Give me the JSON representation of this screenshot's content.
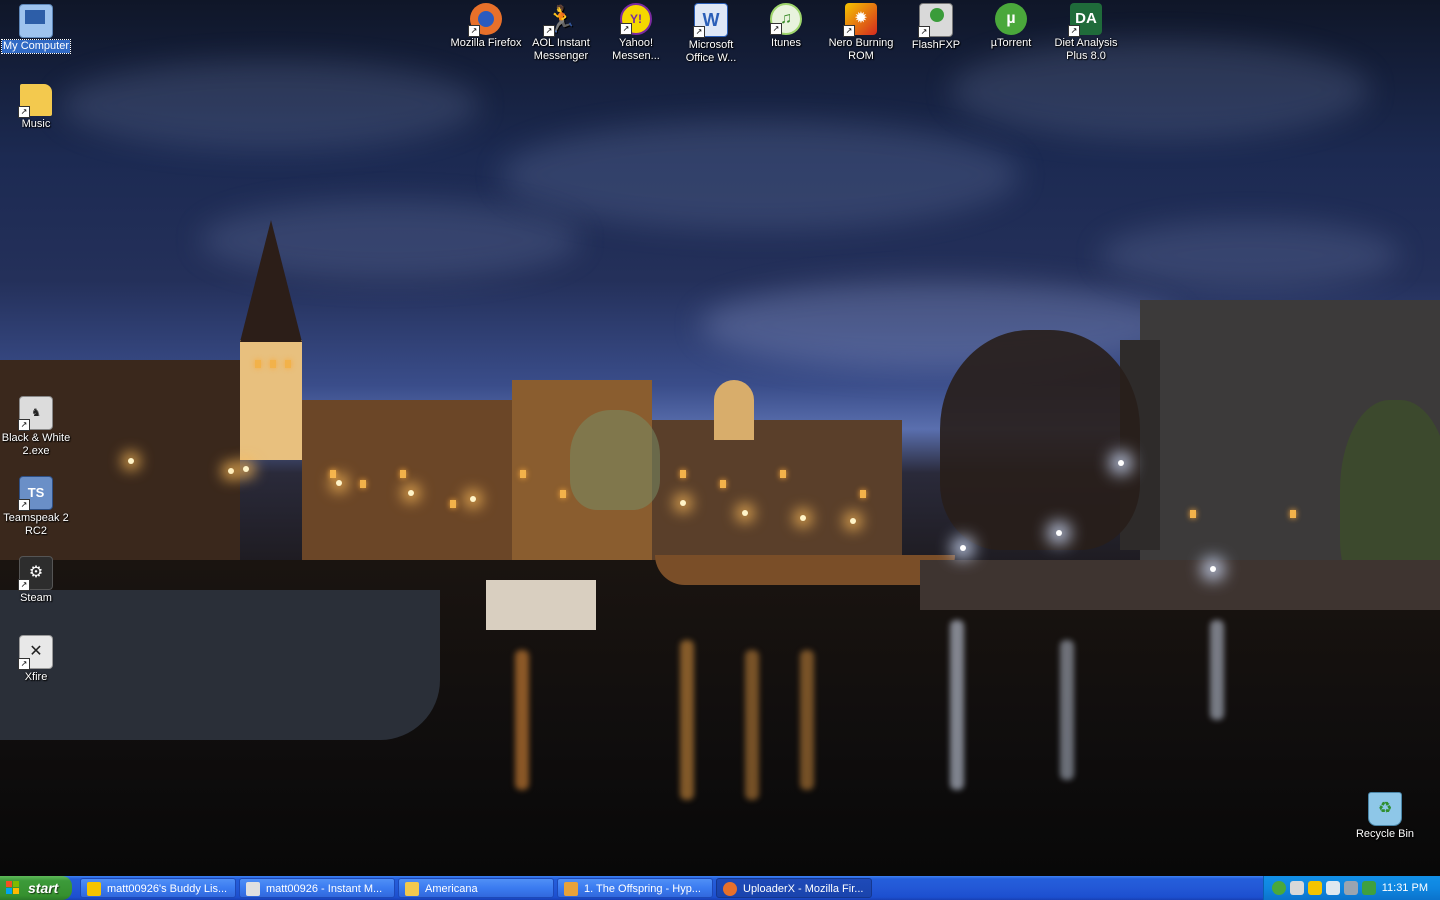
{
  "desktop": {
    "left_icons": [
      {
        "label": "My Computer",
        "icon": "computer-icon",
        "color": "#9ec3ee",
        "selected": true
      },
      {
        "label": "Music",
        "icon": "folder-icon",
        "color": "#f3c94e"
      },
      {
        "label": "Black & White 2.exe",
        "icon": "bw2-game-icon",
        "color": "#dcdcdc"
      },
      {
        "label": "Teamspeak 2 RC2",
        "icon": "teamspeak-icon",
        "color": "#6a8fc7"
      },
      {
        "label": "Steam",
        "icon": "steam-icon",
        "color": "#2d2d2d"
      },
      {
        "label": "Xfire",
        "icon": "xfire-icon",
        "color": "#e8e8e8"
      }
    ],
    "top_icons": [
      {
        "label": "Mozilla Firefox",
        "icon": "firefox-icon",
        "color": "#e8702a"
      },
      {
        "label": "AOL Instant Messenger",
        "icon": "aim-icon",
        "color": "#f5c400"
      },
      {
        "label": "Yahoo! Messen...",
        "icon": "yahoo-messenger-icon",
        "color": "#7b2aa0"
      },
      {
        "label": "Microsoft Office W...",
        "icon": "word-icon",
        "color": "#2b5fb8"
      },
      {
        "label": "Itunes",
        "icon": "itunes-icon",
        "color": "#9ed56c"
      },
      {
        "label": "Nero Burning ROM",
        "icon": "nero-icon",
        "color": "#d42a1f"
      },
      {
        "label": "FlashFXP",
        "icon": "flashfxp-icon",
        "color": "#3a9c3a"
      },
      {
        "label": "µTorrent",
        "icon": "utorrent-icon",
        "color": "#4aa83b"
      },
      {
        "label": "Diet Analysis Plus 8.0",
        "icon": "da-icon",
        "color": "#1f6b3a"
      }
    ],
    "recycle_bin": {
      "label": "Recycle Bin",
      "icon": "recycle-bin-icon",
      "color": "#8ec7e8"
    }
  },
  "taskbar": {
    "start_label": "start",
    "tasks": [
      {
        "label": "matt00926's Buddy Lis...",
        "icon": "aim-icon",
        "color": "#f5c400",
        "active": false
      },
      {
        "label": "matt00926 - Instant M...",
        "icon": "instant-message-icon",
        "color": "#e0e0e0",
        "active": false
      },
      {
        "label": "Americana",
        "icon": "folder-icon",
        "color": "#f3c94e",
        "active": false
      },
      {
        "label": "1. The Offspring - Hyp...",
        "icon": "winamp-icon",
        "color": "#e8a23a",
        "active": false
      },
      {
        "label": "UploaderX - Mozilla Fir...",
        "icon": "firefox-icon",
        "color": "#e8702a",
        "active": true
      }
    ],
    "tray_icons": [
      "utorrent-icon",
      "network-icon",
      "aim-icon",
      "steam-icon",
      "volume-icon",
      "xfire-icon"
    ],
    "clock": "11:31 PM"
  }
}
